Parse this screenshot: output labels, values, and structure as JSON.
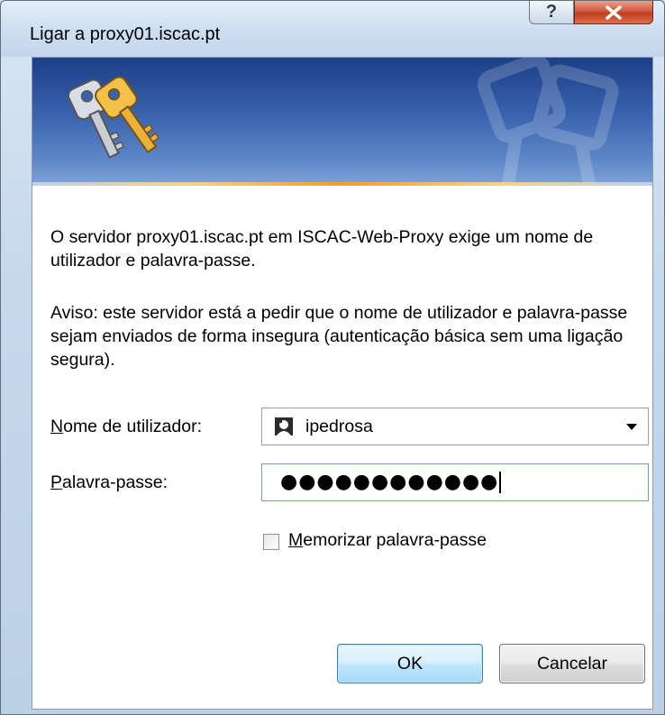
{
  "window": {
    "title": "Ligar a proxy01.iscac.pt",
    "help_label": "?",
    "close_label": "X"
  },
  "message": {
    "line1": "O servidor proxy01.iscac.pt em ISCAC-Web-Proxy exige um nome de utilizador e palavra-passe.",
    "warning": "Aviso: este servidor está a pedir que o nome de utilizador e palavra-passe sejam enviados de forma insegura (autenticação básica sem uma ligação segura)."
  },
  "form": {
    "username_label_accel": "N",
    "username_label_rest": "ome de utilizador:",
    "username_value": "ipedrosa",
    "password_label_accel": "P",
    "password_label_rest": "alavra-passe:",
    "password_value": "●●●●●●●●●●●●",
    "remember_label_accel": "M",
    "remember_label_rest": "emorizar palavra-passe",
    "remember_checked": false
  },
  "buttons": {
    "ok_label": "OK",
    "cancel_label": "Cancelar"
  },
  "colors": {
    "banner_top": "#1c3f87",
    "banner_bottom": "#7ea3d8",
    "accent_line": "#f39c2c",
    "close_button": "#c13c1e"
  }
}
